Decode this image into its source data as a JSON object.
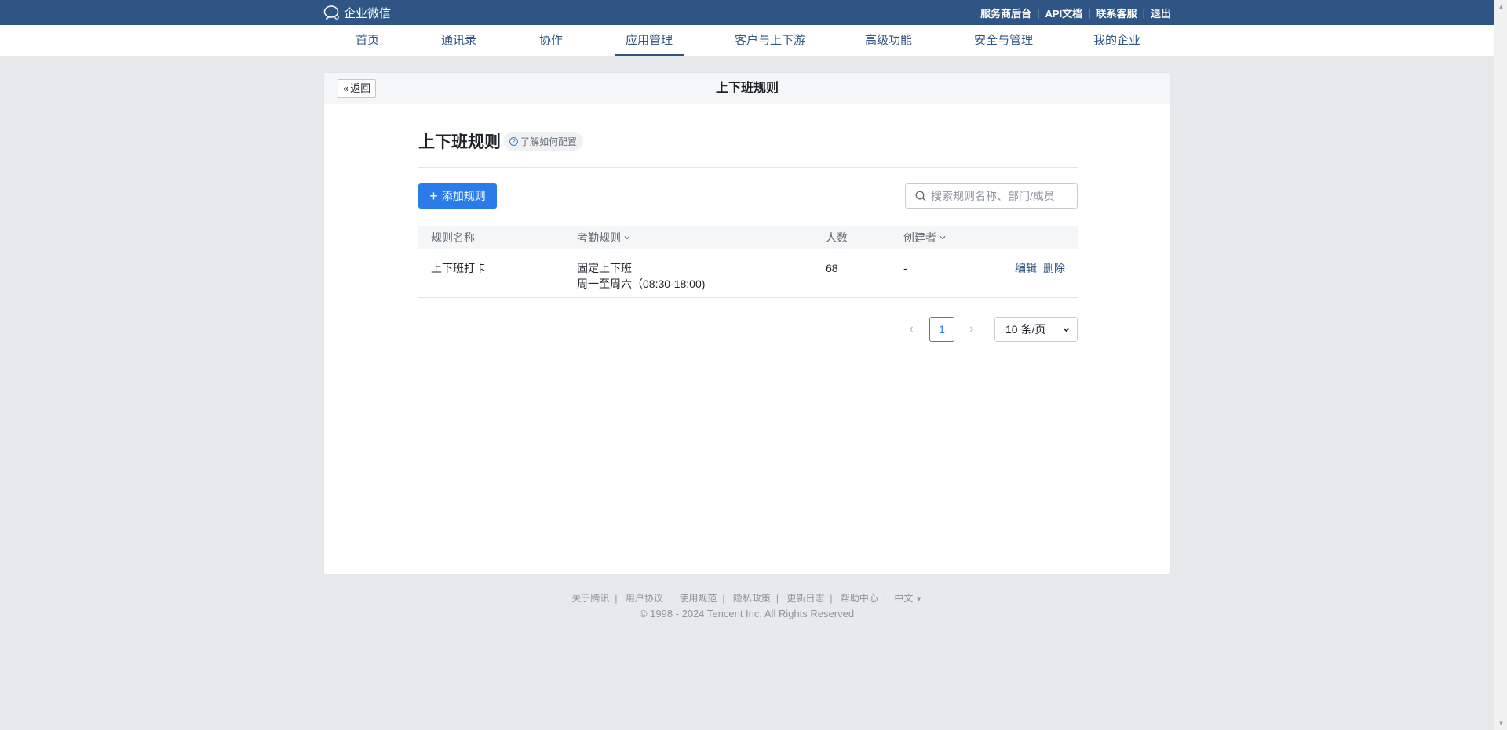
{
  "topbar": {
    "brand": "企业微信",
    "links": [
      "服务商后台",
      "API文档",
      "联系客服",
      "退出"
    ]
  },
  "nav": {
    "items": [
      "首页",
      "通讯录",
      "协作",
      "应用管理",
      "客户与上下游",
      "高级功能",
      "安全与管理",
      "我的企业"
    ],
    "active": "应用管理"
  },
  "card": {
    "back_label": "返回",
    "title": "上下班规则"
  },
  "main": {
    "heading": "上下班规则",
    "howto_label": "了解如何配置",
    "add_button": "添加规则",
    "search_placeholder": "搜索规则名称、部门/成员"
  },
  "table": {
    "headers": {
      "name": "规则名称",
      "rule": "考勤规则",
      "count": "人数",
      "creator": "创建者"
    },
    "rows": [
      {
        "name": "上下班打卡",
        "rule_type": "固定上下班",
        "rule_time": "周一至周六（08:30-18:00)",
        "count": "68",
        "creator": "-",
        "edit": "编辑",
        "delete": "删除"
      }
    ]
  },
  "pagination": {
    "current_page": "1",
    "page_size": "10 条/页"
  },
  "footer": {
    "links": [
      "关于腾讯",
      "用户协议",
      "使用规范",
      "隐私政策",
      "更新日志",
      "帮助中心"
    ],
    "language": "中文",
    "copyright": "© 1998 - 2024 Tencent Inc. All Rights Reserved"
  },
  "colors": {
    "brand_blue": "#2f5584",
    "primary": "#2b7ce9",
    "background": "#e8e9eb"
  }
}
